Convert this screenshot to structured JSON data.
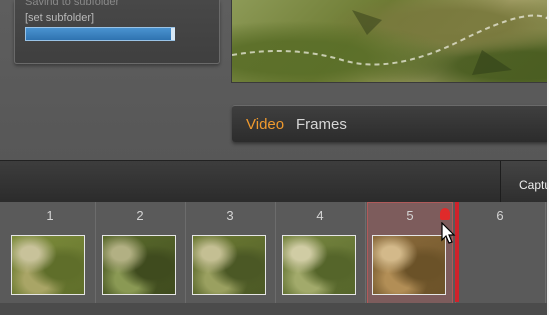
{
  "subfolder_panel": {
    "fragment_text": "Saving to subfolder",
    "label": "[set subfolder]"
  },
  "mode_bar": {
    "tabs": [
      {
        "label": "Video",
        "active": true,
        "color": "#f09a2e"
      },
      {
        "label": "Frames",
        "active": false,
        "color": "#d6d6d6"
      }
    ]
  },
  "header": {
    "capture_label": "Capture"
  },
  "strip": {
    "selected_index": 5,
    "accent_color": "#d0222b",
    "slots": [
      {
        "number": "1",
        "has_thumb": true
      },
      {
        "number": "2",
        "has_thumb": true
      },
      {
        "number": "3",
        "has_thumb": true
      },
      {
        "number": "4",
        "has_thumb": true
      },
      {
        "number": "5",
        "has_thumb": true
      },
      {
        "number": "6",
        "has_thumb": false
      }
    ]
  }
}
